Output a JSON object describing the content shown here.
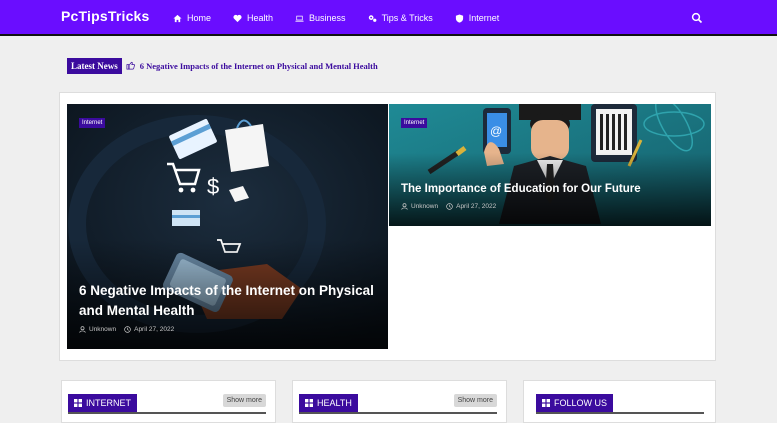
{
  "header": {
    "brand": "PcTipsTricks",
    "nav": [
      {
        "label": "Home",
        "icon": "home-icon"
      },
      {
        "label": "Health",
        "icon": "heart-icon"
      },
      {
        "label": "Business",
        "icon": "laptop-icon"
      },
      {
        "label": "Tips & Tricks",
        "icon": "gears-icon"
      },
      {
        "label": "Internet",
        "icon": "shield-icon"
      }
    ],
    "search_icon": "search-icon"
  },
  "ticker": {
    "label": "Latest News",
    "headline": "6 Negative Impacts of the Internet on Physical and Mental Health"
  },
  "featured": [
    {
      "tag": "Internet",
      "title": "6 Negative Impacts of the Internet on Physical and Mental Health",
      "author": "Unknown",
      "date": "April 27, 2022"
    },
    {
      "tag": "Internet",
      "title": "The Importance of Education for Our Future",
      "author": "Unknown",
      "date": "April 27, 2022"
    }
  ],
  "widgets": [
    {
      "title": "INTERNET",
      "more": "Show more"
    },
    {
      "title": "HEALTH",
      "more": "Show more"
    },
    {
      "title": "FOLLOW US"
    }
  ],
  "colors": {
    "brand": "#6a0dff",
    "accent": "#3b0b9e"
  }
}
